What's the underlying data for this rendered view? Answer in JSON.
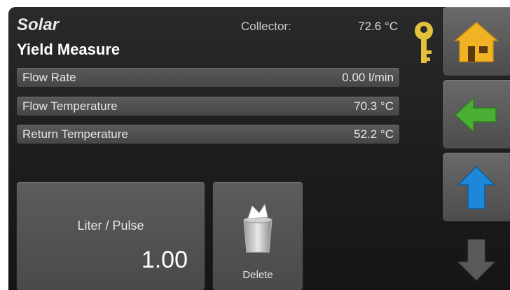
{
  "header": {
    "title": "Solar",
    "subtitle": "Yield Measure",
    "collector_label": "Collector:",
    "collector_value": "72.6 °C"
  },
  "rows": [
    {
      "label": "Flow Rate",
      "value": "0.00 l/min"
    },
    {
      "label": "Flow Temperature",
      "value": "70.3 °C"
    },
    {
      "label": "Return Temperature",
      "value": "52.2 °C"
    }
  ],
  "pulse": {
    "label": "Liter / Pulse",
    "value": "1.00"
  },
  "delete": {
    "label": "Delete"
  },
  "nav": {
    "home": "home-icon",
    "back": "arrow-left-icon",
    "up": "arrow-up-icon",
    "down": "arrow-down-icon"
  },
  "colors": {
    "home": "#f0b323",
    "back": "#4caf35",
    "up": "#1e88d8",
    "down": "#5a5a5a",
    "key": "#e2c23a"
  }
}
